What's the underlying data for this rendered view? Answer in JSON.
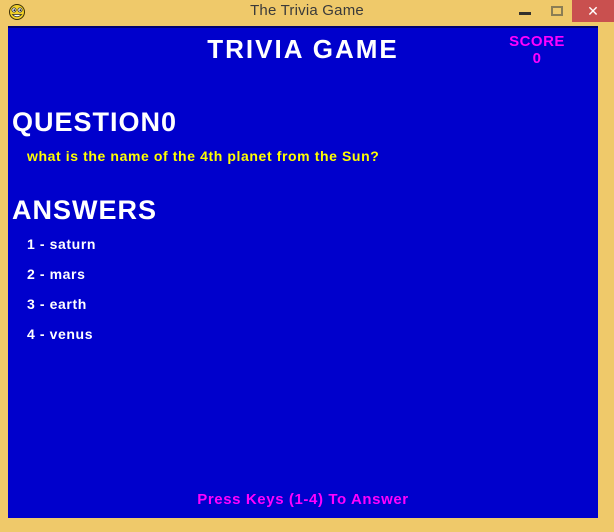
{
  "window": {
    "title": "The Trivia Game",
    "icon": "game-face-icon",
    "controls": {
      "minimize_label": "–",
      "maximize_label": "□",
      "close_label": "✕"
    },
    "colors": {
      "frame": "#efc96a",
      "canvas": "#0000cc",
      "close_button": "#c9504f",
      "title_text": "#3a3a3a",
      "heading_text": "#ffffff",
      "question_text": "#ffff00",
      "accent_magenta": "#ff00ff"
    }
  },
  "game": {
    "title": "TRIVIA GAME",
    "score_label": "SCORE",
    "score_value": "0",
    "question_heading": "QUESTION0",
    "question_text": "what is the name of the 4th planet from the Sun?",
    "answers_heading": "ANSWERS",
    "answers": [
      {
        "label": "1 - saturn"
      },
      {
        "label": "2 - mars"
      },
      {
        "label": "3 - earth"
      },
      {
        "label": "4 - venus"
      }
    ],
    "prompt": "Press Keys (1-4) To Answer"
  }
}
